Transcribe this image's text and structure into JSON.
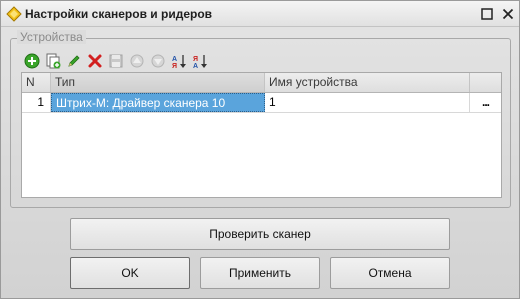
{
  "window": {
    "title": "Настройки сканеров и ридеров"
  },
  "group": {
    "label": "Устройства"
  },
  "table": {
    "columns": [
      "N",
      "Тип",
      "Имя устройства",
      ""
    ],
    "rows": [
      {
        "n": "1",
        "type": "Штрих-М: Драйвер сканера 10",
        "name": "1",
        "action": "..."
      }
    ]
  },
  "buttons": {
    "check_scanner": "Проверить сканер",
    "ok": "OK",
    "apply": "Применить",
    "cancel": "Отмена"
  },
  "colors": {
    "selection": "#5aa4dc",
    "add_green": "#3aa52a",
    "delete_red": "#d21f1f"
  },
  "toolbar_icons": [
    "add-icon",
    "copy-icon",
    "edit-icon",
    "delete-icon",
    "save-icon",
    "move-up-icon",
    "move-down-icon",
    "sort-ascending-icon",
    "sort-descending-icon"
  ]
}
